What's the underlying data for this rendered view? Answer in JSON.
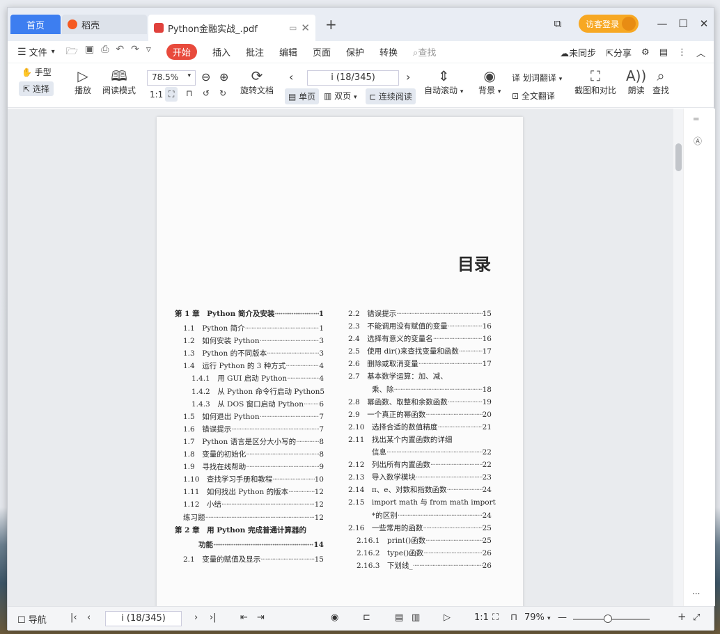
{
  "window": {
    "title": "Python金融实战"
  },
  "tabs": {
    "home": "首页",
    "daoke": "稻壳",
    "pdf": "Python金融实战_.pdf"
  },
  "login": "访客登录",
  "menu": {
    "file": "文件",
    "start": "开始",
    "insert": "插入",
    "annotate": "批注",
    "edit": "编辑",
    "page": "页面",
    "protect": "保护",
    "convert": "转换",
    "search": "查找",
    "unsync": "未同步",
    "share": "分享"
  },
  "toolbar": {
    "hand": "手型",
    "select": "选择",
    "play": "播放",
    "read_mode": "阅读模式",
    "zoom": "78.5%",
    "rotate": "旋转文档",
    "page_indicator": "i (18/345)",
    "single": "单页",
    "double": "双页",
    "continuous": "连续阅读",
    "autoscroll": "自动滚动",
    "background": "背景",
    "word_translate": "划词翻译",
    "full_translate": "全文翻译",
    "compare": "截图和对比",
    "read_aloud": "朗读",
    "find": "查找"
  },
  "document": {
    "heading": "目录",
    "left": [
      {
        "t": "第 1 章　Python 简介及安装",
        "p": "1",
        "c": "chap"
      },
      {
        "t": "1.1　Python 简介",
        "p": "1",
        "c": "ind1"
      },
      {
        "t": "1.2　如何安装 Python",
        "p": "3",
        "c": "ind1"
      },
      {
        "t": "1.3　Python 的不同版本",
        "p": "3",
        "c": "ind1"
      },
      {
        "t": "1.4　运行 Python 的 3 种方式",
        "p": "4",
        "c": "ind1"
      },
      {
        "t": "1.4.1　用 GUI 启动 Python",
        "p": "4",
        "c": "ind2"
      },
      {
        "t": "1.4.2　从 Python 命令行启动 Python",
        "p": "5",
        "c": "ind2"
      },
      {
        "t": "1.4.3　从 DOS 窗口启动 Python",
        "p": "6",
        "c": "ind2"
      },
      {
        "t": "1.5　如何退出 Python",
        "p": "7",
        "c": "ind1"
      },
      {
        "t": "1.6　错误提示",
        "p": "7",
        "c": "ind1"
      },
      {
        "t": "1.7　Python 语言是区分大小写的",
        "p": "8",
        "c": "ind1"
      },
      {
        "t": "1.8　变量的初始化",
        "p": "8",
        "c": "ind1"
      },
      {
        "t": "1.9　寻找在线帮助",
        "p": "9",
        "c": "ind1"
      },
      {
        "t": "1.10　查找学习手册和教程",
        "p": "10",
        "c": "ind1"
      },
      {
        "t": "1.11　如何找出 Python 的版本",
        "p": "12",
        "c": "ind1"
      },
      {
        "t": "1.12　小结",
        "p": "12",
        "c": "ind1"
      },
      {
        "t": "练习题",
        "p": "12",
        "c": "ind1"
      },
      {
        "t": "第 2 章　用 Python 完成普通计算器的",
        "p": "",
        "c": "chap nodots"
      },
      {
        "t": "功能",
        "p": "14",
        "c": "chap ind3"
      },
      {
        "t": "2.1　变量的赋值及显示",
        "p": "15",
        "c": "ind1"
      }
    ],
    "right": [
      {
        "t": "2.2　错误提示",
        "p": "15",
        "c": ""
      },
      {
        "t": "2.3　不能调用没有赋值的变量",
        "p": "16",
        "c": ""
      },
      {
        "t": "2.4　选择有意义的变量名",
        "p": "16",
        "c": ""
      },
      {
        "t": "2.5　使用 dir()来查找变量和函数",
        "p": "17",
        "c": ""
      },
      {
        "t": "2.6　删除或取消变量",
        "p": "17",
        "c": ""
      },
      {
        "t": "2.7　基本数学运算：加、减、",
        "p": "",
        "c": "nodots"
      },
      {
        "t": "乘、除",
        "p": "18",
        "c": "ind3"
      },
      {
        "t": "2.8　幂函数、取整和余数函数",
        "p": "19",
        "c": ""
      },
      {
        "t": "2.9　一个真正的幂函数",
        "p": "20",
        "c": ""
      },
      {
        "t": "2.10　选择合适的数值精度",
        "p": "21",
        "c": ""
      },
      {
        "t": "2.11　找出某个内置函数的详细",
        "p": "",
        "c": "nodots"
      },
      {
        "t": "信息",
        "p": "22",
        "c": "ind3"
      },
      {
        "t": "2.12　列出所有内置函数",
        "p": "22",
        "c": ""
      },
      {
        "t": "2.13　导入数学模块",
        "p": "23",
        "c": ""
      },
      {
        "t": "2.14　π、e、对数和指数函数",
        "p": "24",
        "c": ""
      },
      {
        "t": "2.15　import math 与 from math import",
        "p": "",
        "c": "nodots"
      },
      {
        "t": "*的区别",
        "p": "24",
        "c": "ind3"
      },
      {
        "t": "2.16　一些常用的函数",
        "p": "25",
        "c": ""
      },
      {
        "t": "2.16.1　print()函数",
        "p": "25",
        "c": "ind1"
      },
      {
        "t": "2.16.2　type()函数",
        "p": "26",
        "c": "ind1"
      },
      {
        "t": "2.16.3　下划线_",
        "p": "26",
        "c": "ind1"
      }
    ]
  },
  "status": {
    "nav": "导航",
    "page": "i (18/345)",
    "zoom": "79%"
  }
}
